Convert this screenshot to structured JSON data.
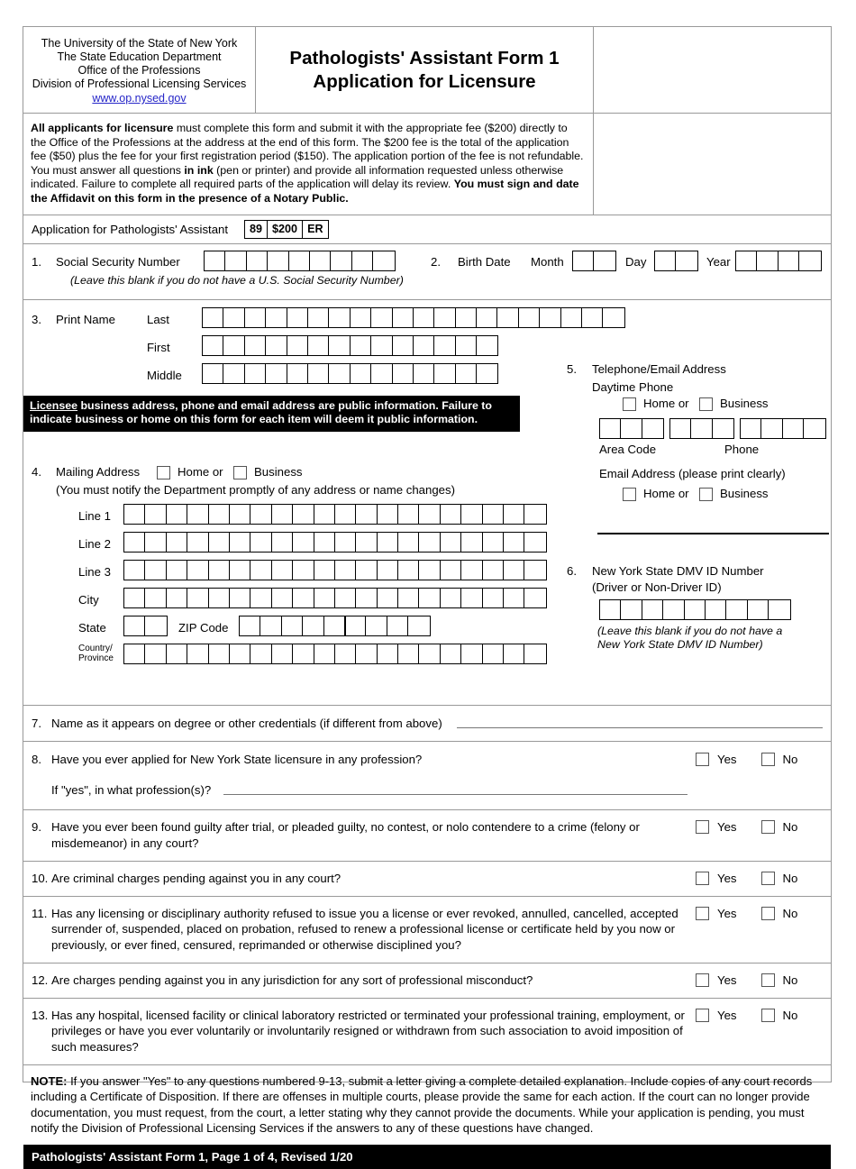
{
  "header": {
    "agency_lines": [
      "The University of the State of New York",
      "The State Education Department",
      "Office of the Professions",
      "Division of Professional Licensing Services"
    ],
    "website": "www.op.nysed.gov",
    "title_line1": "Pathologists' Assistant Form 1",
    "title_line2": "Application for Licensure"
  },
  "instructions": {
    "lead_bold": "All applicants for licensure",
    "body": " must complete this form and submit it with the appropriate fee ($200) directly to the Office of the Professions at the address at the end of this form. The $200 fee is the total of the application fee ($50) plus the fee for your first registration period ($150). The application portion of the fee is not refundable. You must answer all questions ",
    "ink_bold": "in ink",
    "body2": " (pen or printer) and provide all information requested unless otherwise indicated. Failure to complete all required parts of the application will delay its review. ",
    "tail_bold": "You must sign and date the Affidavit on this form in the presence of a Notary Public."
  },
  "appbar": {
    "label": "Application for Pathologists' Assistant",
    "code1": "89",
    "code2": "$200",
    "code3": "ER"
  },
  "q1": {
    "num": "1.",
    "label": "Social Security Number",
    "boxes": 9,
    "hint": "(Leave this blank if you do not have a U.S. Social Security Number)"
  },
  "q2": {
    "num": "2.",
    "label": "Birth Date",
    "month_label": "Month",
    "month_boxes": 2,
    "day_label": "Day",
    "day_boxes": 2,
    "year_label": "Year",
    "year_boxes": 4
  },
  "q3": {
    "num": "3.",
    "label": "Print Name",
    "rows": [
      {
        "label": "Last",
        "boxes": 20
      },
      {
        "label": "First",
        "boxes": 14
      },
      {
        "label": "Middle",
        "boxes": 14
      }
    ]
  },
  "notice": {
    "underlined": "Licensee",
    "text": " business address, phone and email address are public information. Failure to indicate business or home on this form for each item will deem it public information."
  },
  "q4": {
    "num": "4.",
    "label": "Mailing Address",
    "home": "Home or",
    "business": "Business",
    "sub": "(You must notify the Department promptly of any address or name changes)",
    "rows": [
      {
        "label": "Line 1",
        "boxes": 20
      },
      {
        "label": "Line 2",
        "boxes": 20
      },
      {
        "label": "Line 3",
        "boxes": 20
      },
      {
        "label": "City",
        "boxes": 20
      }
    ],
    "state_label": "State",
    "state_boxes": 2,
    "zip_label": "ZIP Code",
    "zip_boxes": 5,
    "zip4_boxes": 4,
    "country_label_l1": "Country/",
    "country_label_l2": "Province",
    "country_boxes": 20
  },
  "q5": {
    "num": "5.",
    "label": "Telephone/Email Address",
    "daytime": "Daytime Phone",
    "home": "Home or",
    "business": "Business",
    "area_boxes": 3,
    "prefix_boxes": 3,
    "line_boxes": 4,
    "area_label": "Area Code",
    "phone_label": "Phone",
    "email_label": "Email Address (please print clearly)",
    "email_home": "Home or",
    "email_business": "Business"
  },
  "q6": {
    "num": "6.",
    "label_l1": "New York State DMV ID Number",
    "label_l2": "(Driver or Non-Driver ID)",
    "boxes": 9,
    "hint_l1": "(Leave this blank if you do not have a",
    "hint_l2": "New York State DMV ID Number)"
  },
  "questions": [
    {
      "num": "7.",
      "text": "Name as it appears on degree or other credentials (if different from above)",
      "has_yesno": false,
      "has_line": true
    },
    {
      "num": "8.",
      "text": "Have you ever applied for New York State licensure in any profession?",
      "sub_text": "If \"yes\", in what profession(s)?",
      "has_yesno": true,
      "has_sub_line": true
    },
    {
      "num": "9.",
      "text": "Have you ever been found guilty after trial, or pleaded guilty, no contest, or nolo contendere to a crime (felony or misdemeanor) in any court?",
      "has_yesno": true
    },
    {
      "num": "10.",
      "text": "Are criminal charges pending against you in any court?",
      "has_yesno": true
    },
    {
      "num": "11.",
      "text": "Has any licensing or disciplinary authority refused to issue you a license or ever revoked, annulled, cancelled, accepted surrender of, suspended, placed on probation, refused to renew a professional license or certificate held by you now or previously, or ever fined, censured, reprimanded or otherwise disciplined you?",
      "has_yesno": true
    },
    {
      "num": "12.",
      "text": "Are charges pending against you in any jurisdiction for any sort of professional misconduct?",
      "has_yesno": true
    },
    {
      "num": "13.",
      "text": "Has any hospital, licensed facility or clinical laboratory restricted or terminated your professional training, employment, or privileges or have you ever voluntarily or involuntarily resigned or withdrawn from such association to avoid imposition of such measures?",
      "has_yesno": true
    }
  ],
  "yes_label": "Yes",
  "no_label": "No",
  "note": {
    "bold": "NOTE:",
    "text": " If you answer \"Yes\" to any questions numbered 9-13, submit a letter giving a complete detailed explanation. Include copies of any court records including a Certificate of Disposition. If there are offenses in multiple courts, please provide the same for each action. If the court can no longer provide documentation, you must request, from the court, a letter stating why they cannot provide the documents. While your application is pending, you must notify the Division of Professional Licensing Services if the answers to any of these questions have changed."
  },
  "footer": {
    "text": "Pathologists' Assistant Form 1, Page 1 of 4, Revised 1/20"
  }
}
